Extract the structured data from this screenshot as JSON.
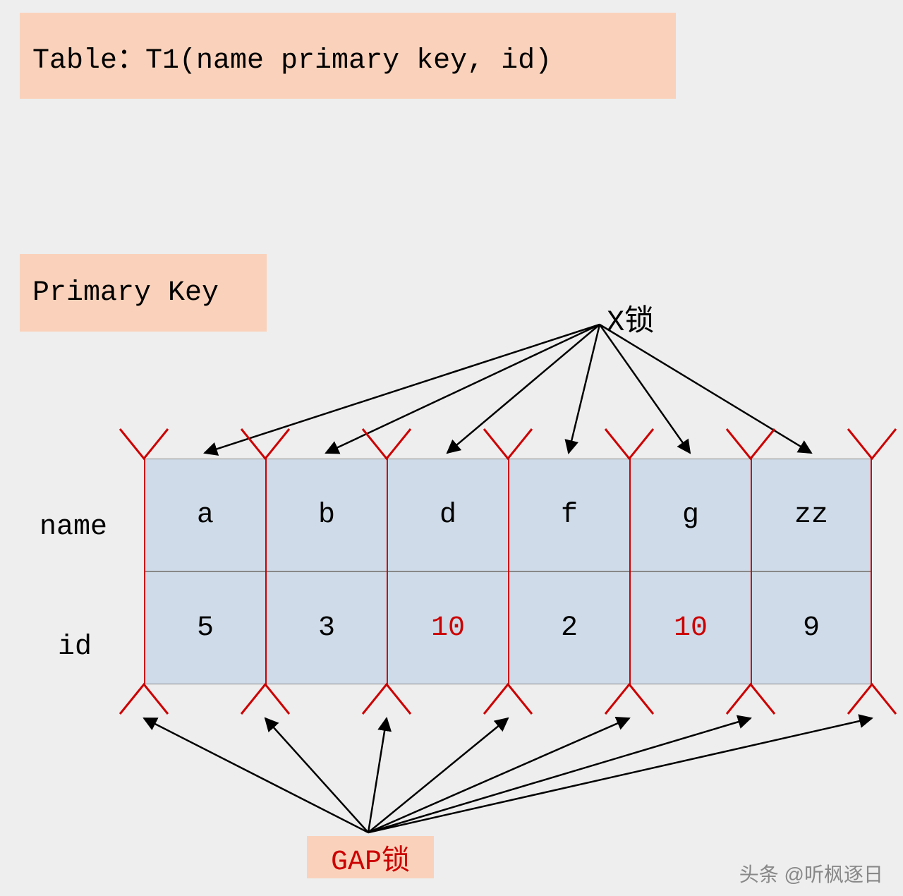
{
  "title": "Table：T1(name primary key, id)",
  "primary_key_label": "Primary Key",
  "xlock_label": "X锁",
  "gaplock_label": "GAP锁",
  "row_labels": {
    "name": "name",
    "id": "id"
  },
  "columns": [
    {
      "name": "a",
      "id": "5",
      "id_highlight": false
    },
    {
      "name": "b",
      "id": "3",
      "id_highlight": false
    },
    {
      "name": "d",
      "id": "10",
      "id_highlight": true
    },
    {
      "name": "f",
      "id": "2",
      "id_highlight": false
    },
    {
      "name": "g",
      "id": "10",
      "id_highlight": true
    },
    {
      "name": "zz",
      "id": "9",
      "id_highlight": false
    }
  ],
  "watermark": "头条 @听枫逐日",
  "colors": {
    "box_bg": "#fad2bb",
    "cell_bg": "#cfdbe8",
    "accent_red": "#cc0000",
    "page_bg": "#eeeeee"
  },
  "chart_data": {
    "type": "table",
    "title": "T1 primary key index — X locks on records, GAP locks on gaps",
    "records": [
      {
        "name": "a",
        "id": 5
      },
      {
        "name": "b",
        "id": 3
      },
      {
        "name": "d",
        "id": 10
      },
      {
        "name": "f",
        "id": 2
      },
      {
        "name": "g",
        "id": 10
      },
      {
        "name": "zz",
        "id": 9
      }
    ],
    "x_lock_targets": [
      "a",
      "b",
      "d",
      "f",
      "g",
      "zz"
    ],
    "gap_lock_positions": [
      "(-∞,a)",
      "(a,b)",
      "(b,d)",
      "(d,f)",
      "(f,g)",
      "(g,zz)",
      "(zz,+∞)"
    ]
  }
}
